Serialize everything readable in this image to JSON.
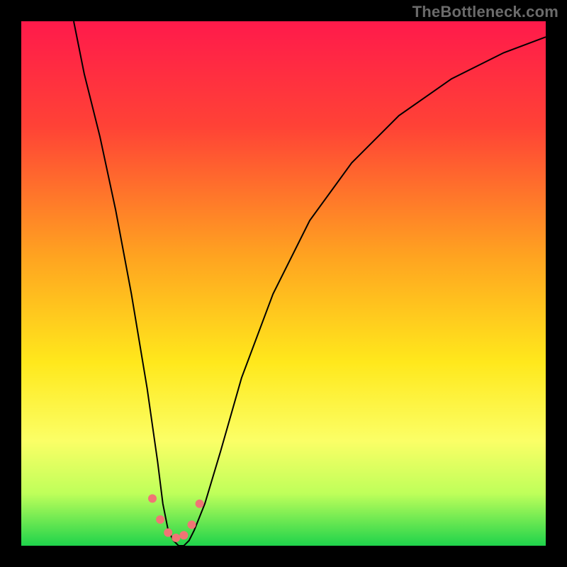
{
  "attribution": "TheBottleneck.com",
  "chart_data": {
    "type": "line",
    "title": "",
    "xlabel": "",
    "ylabel": "",
    "xlim": [
      0,
      100
    ],
    "ylim": [
      0,
      100
    ],
    "background_gradient": {
      "stops": [
        {
          "offset": 0,
          "color": "#ff1a4b"
        },
        {
          "offset": 20,
          "color": "#ff4236"
        },
        {
          "offset": 45,
          "color": "#ffa420"
        },
        {
          "offset": 65,
          "color": "#ffe81c"
        },
        {
          "offset": 80,
          "color": "#fbff66"
        },
        {
          "offset": 90,
          "color": "#bfff5a"
        },
        {
          "offset": 100,
          "color": "#1fd34b"
        }
      ]
    },
    "series": [
      {
        "name": "bottleneck-curve",
        "color": "#000000",
        "x": [
          10,
          12,
          15,
          18,
          21,
          24,
          26,
          27,
          28,
          29,
          30,
          31,
          32,
          33,
          35,
          38,
          42,
          48,
          55,
          63,
          72,
          82,
          92,
          100
        ],
        "y": [
          100,
          90,
          78,
          64,
          48,
          30,
          16,
          8,
          3,
          1,
          0,
          0,
          1,
          3,
          8,
          18,
          32,
          48,
          62,
          73,
          82,
          89,
          94,
          97
        ]
      }
    ],
    "markers": {
      "name": "highlighted-points",
      "color": "#f07575",
      "radius": 6,
      "x": [
        25,
        26.5,
        28,
        29.5,
        31,
        32.5,
        34
      ],
      "y": [
        9,
        5,
        2.5,
        1.5,
        2,
        4,
        8
      ]
    }
  }
}
